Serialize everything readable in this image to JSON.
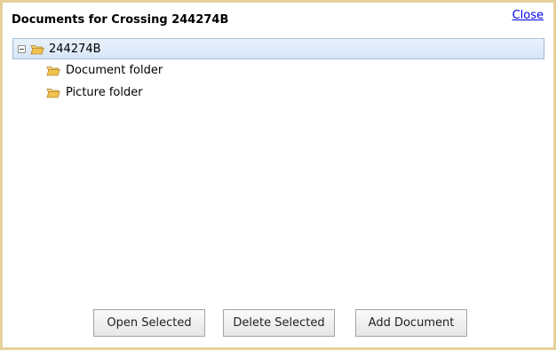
{
  "dialog": {
    "title": "Documents for Crossing 244274B",
    "close_label": "Close"
  },
  "tree": {
    "root": {
      "label": "244274B",
      "icon": "folder-open-icon",
      "expanded": true
    },
    "children": [
      {
        "label": "Document folder",
        "icon": "folder-open-icon"
      },
      {
        "label": "Picture folder",
        "icon": "folder-open-icon"
      }
    ]
  },
  "actions": {
    "open_selected": "Open Selected",
    "delete_selected": "Delete Selected",
    "add_document": "Add Document"
  },
  "colors": {
    "border": "#e6d19a",
    "folder": "#e8b84a",
    "selection": "#d6e6f7",
    "link": "#0000ee"
  }
}
